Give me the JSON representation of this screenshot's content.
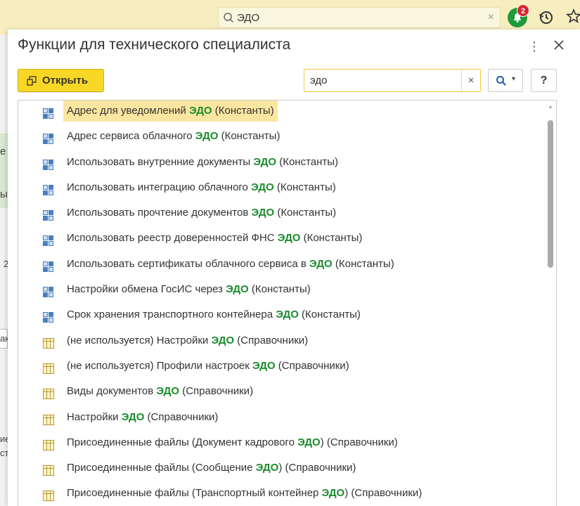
{
  "app": {
    "search_text": "ЭДО",
    "clear_glyph": "×",
    "notification_count": "2"
  },
  "background": {
    "fragments": [
      "е",
      "ых",
      "2",
      "ак",
      "ие",
      "ст"
    ]
  },
  "dialog": {
    "title": "Функции для технического специалиста",
    "more_glyph": "⋮",
    "open_label": "Открыть",
    "search_value": "эдо",
    "search_clear": "×",
    "help_label": "?",
    "dropdown_glyph": "▾"
  },
  "colors": {
    "accent_yellow": "#f9d726",
    "highlight_green": "#1a8b2c",
    "selection": "#fbe6a1",
    "notification_green": "#1e9b3a",
    "badge_red": "#d9262b"
  },
  "items": [
    {
      "pre": "Адрес для уведомлений ",
      "hl": "ЭДО",
      "post": " (Константы)",
      "icon": "constant-icon",
      "selected": true
    },
    {
      "pre": "Адрес сервиса облачного ",
      "hl": "ЭДО",
      "post": " (Константы)",
      "icon": "constant-icon"
    },
    {
      "pre": "Использовать внутренние документы ",
      "hl": "ЭДО",
      "post": " (Константы)",
      "icon": "constant-icon"
    },
    {
      "pre": "Использовать интеграцию облачного ",
      "hl": "ЭДО",
      "post": " (Константы)",
      "icon": "constant-icon"
    },
    {
      "pre": "Использовать прочтение документов ",
      "hl": "ЭДО",
      "post": " (Константы)",
      "icon": "constant-icon"
    },
    {
      "pre": "Использовать реестр доверенностей ФНС ",
      "hl": "ЭДО",
      "post": " (Константы)",
      "icon": "constant-icon"
    },
    {
      "pre": "Использовать сертификаты облачного сервиса в ",
      "hl": "ЭДО",
      "post": " (Константы)",
      "icon": "constant-icon"
    },
    {
      "pre": "Настройки обмена ГосИС через ",
      "hl": "ЭДО",
      "post": " (Константы)",
      "icon": "constant-icon"
    },
    {
      "pre": "Срок хранения транспортного контейнера ",
      "hl": "ЭДО",
      "post": " (Константы)",
      "icon": "constant-icon"
    },
    {
      "pre": "(не используется) Настройки ",
      "hl": "ЭДО",
      "post": " (Справочники)",
      "icon": "catalog-icon"
    },
    {
      "pre": "(не используется) Профили настроек ",
      "hl": "ЭДО",
      "post": " (Справочники)",
      "icon": "catalog-icon"
    },
    {
      "pre": "Виды документов ",
      "hl": "ЭДО",
      "post": " (Справочники)",
      "icon": "catalog-icon"
    },
    {
      "pre": "Настройки ",
      "hl": "ЭДО",
      "post": " (Справочники)",
      "icon": "catalog-icon"
    },
    {
      "pre": "Присоединенные файлы (Документ кадрового ",
      "hl": "ЭДО",
      "post": ") (Справочники)",
      "icon": "catalog-icon"
    },
    {
      "pre": "Присоединенные файлы (Сообщение ",
      "hl": "ЭДО",
      "post": ") (Справочники)",
      "icon": "catalog-icon"
    },
    {
      "pre": "Присоединенные файлы (Транспортный контейнер ",
      "hl": "ЭДО",
      "post": ") (Справочники)",
      "icon": "catalog-icon"
    }
  ]
}
